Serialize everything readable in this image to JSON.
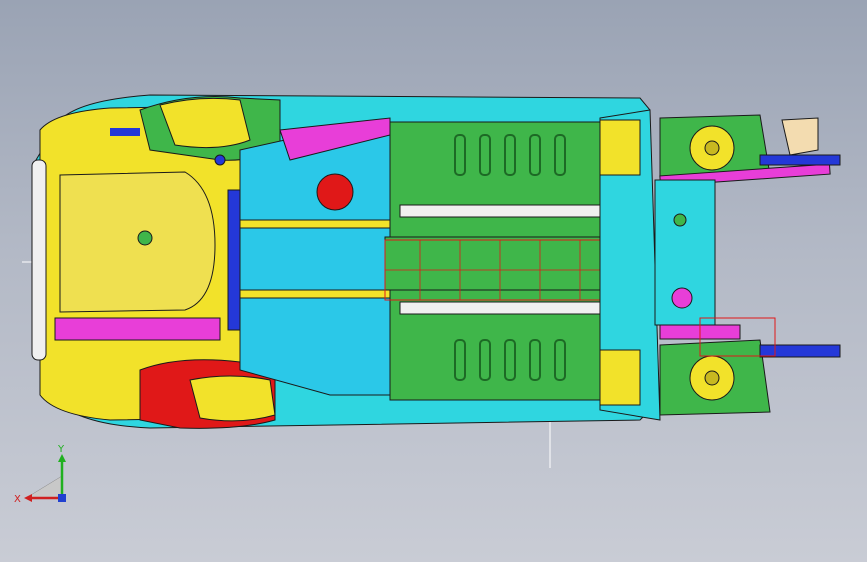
{
  "viewport": {
    "background_top": "#9aa3b4",
    "background_bottom": "#c9ccd5"
  },
  "model": {
    "description_icon": "car-underbody-assembly",
    "part_colors": {
      "yellow": "#f2e22a",
      "cyan": "#2fd6e0",
      "green": "#3fb64a",
      "light_green": "#86e27a",
      "magenta": "#e83ed8",
      "blue": "#2438d8",
      "red": "#e01818",
      "white": "#f0f0f0",
      "grey": "#a0a6b0",
      "tan": "#f3dcb0",
      "pink": "#f59aa0"
    }
  },
  "triad": {
    "x_label": "X",
    "y_label": "Y",
    "x_color": "#d02020",
    "y_color": "#20b020",
    "z_color": "#2040d0"
  }
}
